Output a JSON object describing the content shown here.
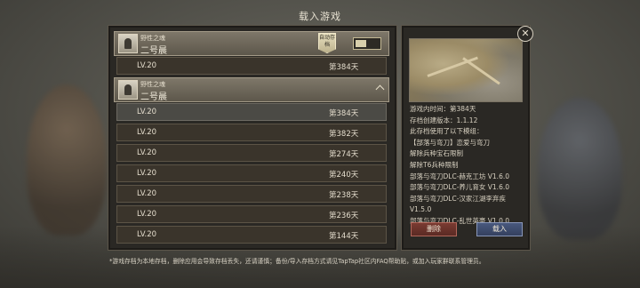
{
  "title": "载入游戏",
  "saves": [
    {
      "tag": "野性之魂",
      "name": "二号晨",
      "autosave_label": "自动存档",
      "expanded": false,
      "entries": [
        {
          "level": "LV.20",
          "days": "第384天"
        }
      ]
    },
    {
      "tag": "野性之魂",
      "name": "二号晨",
      "expanded": true,
      "entries": [
        {
          "level": "LV.20",
          "days": "第384天"
        },
        {
          "level": "LV.20",
          "days": "第382天"
        },
        {
          "level": "LV.20",
          "days": "第274天"
        },
        {
          "level": "LV.20",
          "days": "第240天"
        },
        {
          "level": "LV.20",
          "days": "第238天"
        },
        {
          "level": "LV.20",
          "days": "第236天"
        },
        {
          "level": "LV.20",
          "days": "第144天"
        }
      ]
    }
  ],
  "details": {
    "lines": [
      "游戏内时间：第384天",
      "存档创建版本：1.1.12",
      "此存档使用了以下模组：",
      "【部落与弯刀】恋爱与弯刀",
      "解除兵种宝石限制",
      "解除T6兵种限制",
      "部落与弯刀DLC-赫克工坊 V1.6.0",
      "部落与弯刀DLC-养儿育女 V1.6.0",
      "部落与弯刀DLC-汉家江湖李弃疾",
      "V1.5.0",
      "部落与弯刀DLC-乱世英豪 V1.0.0"
    ],
    "delete_label": "删除",
    "load_label": "载入"
  },
  "footer": "*游戏存档为本地存档，删除应用会导致存档丢失，还请谨慎；备份/导入存档方式请见TapTap社区内FAQ帮助贴，或加入玩家群联系管理员。",
  "icons": {
    "close": "close-icon",
    "collapse": "chevron-up-icon",
    "avatar": "avatar"
  }
}
